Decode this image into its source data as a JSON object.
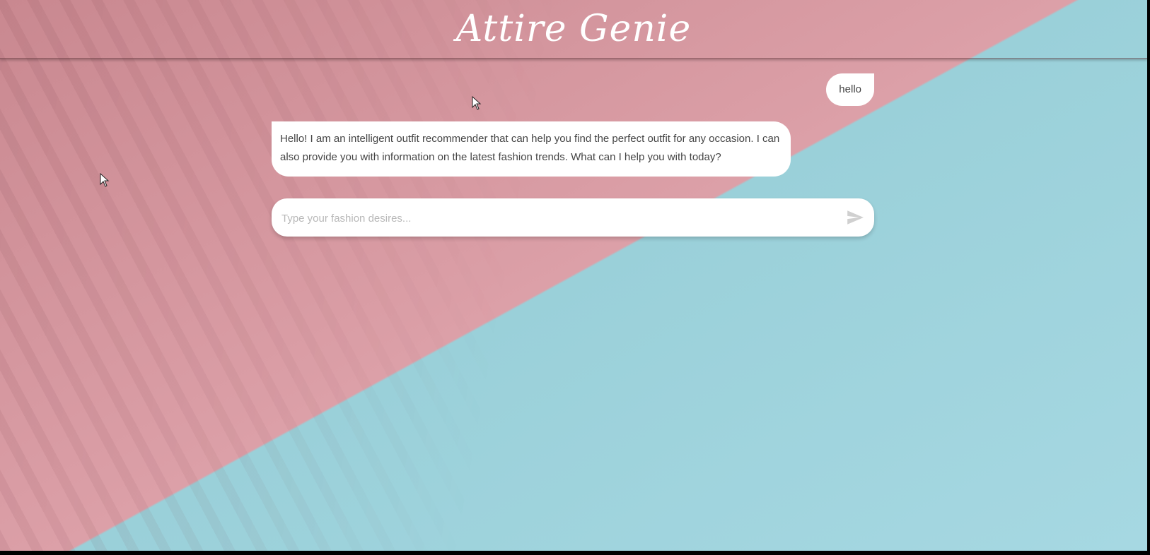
{
  "app": {
    "title": "Attire Genie"
  },
  "chat": {
    "messages": [
      {
        "role": "user",
        "text": "hello"
      },
      {
        "role": "bot",
        "text": "Hello! I am an intelligent outfit recommender that can help you find the perfect outfit for any occasion. I can also provide you with information on the latest fashion trends. What can I help you with today?"
      }
    ],
    "input": {
      "value": "",
      "placeholder": "Type your fashion desires..."
    },
    "send_icon": "send-icon"
  },
  "colors": {
    "pink": "#dca0a8",
    "blue": "#9ad0d9",
    "bubble": "#ffffff",
    "text": "#444444"
  }
}
